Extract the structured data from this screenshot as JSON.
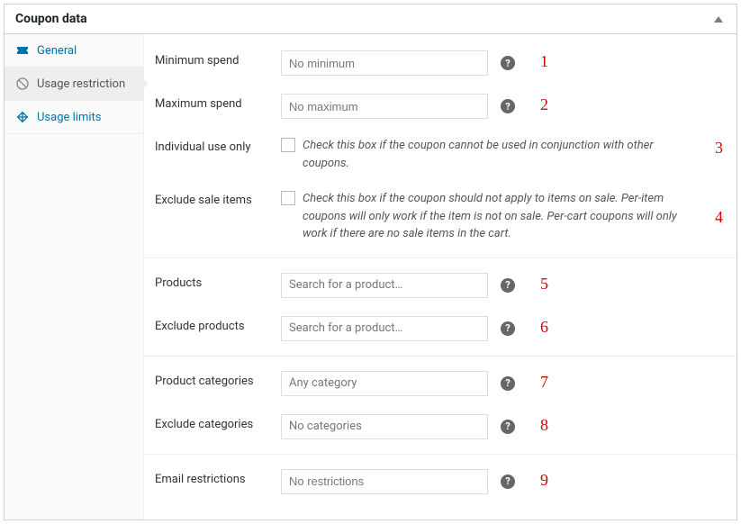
{
  "panel": {
    "title": "Coupon data"
  },
  "sidebar": {
    "items": [
      {
        "label": "General"
      },
      {
        "label": "Usage restriction"
      },
      {
        "label": "Usage limits"
      }
    ]
  },
  "fields": {
    "min_spend": {
      "label": "Minimum spend",
      "placeholder": "No minimum",
      "annot": "1"
    },
    "max_spend": {
      "label": "Maximum spend",
      "placeholder": "No maximum",
      "annot": "2"
    },
    "individual": {
      "label": "Individual use only",
      "desc": "Check this box if the coupon cannot be used in conjunction with other coupons.",
      "annot": "3"
    },
    "exclude_sale": {
      "label": "Exclude sale items",
      "desc": "Check this box if the coupon should not apply to items on sale. Per-item coupons will only work if the item is not on sale. Per-cart coupons will only work if there are no sale items in the cart.",
      "annot": "4"
    },
    "products": {
      "label": "Products",
      "placeholder": "Search for a product…",
      "annot": "5"
    },
    "exclude_products": {
      "label": "Exclude products",
      "placeholder": "Search for a product…",
      "annot": "6"
    },
    "categories": {
      "label": "Product categories",
      "placeholder": "Any category",
      "annot": "7"
    },
    "exclude_categories": {
      "label": "Exclude categories",
      "placeholder": "No categories",
      "annot": "8"
    },
    "email": {
      "label": "Email restrictions",
      "placeholder": "No restrictions",
      "annot": "9"
    }
  }
}
